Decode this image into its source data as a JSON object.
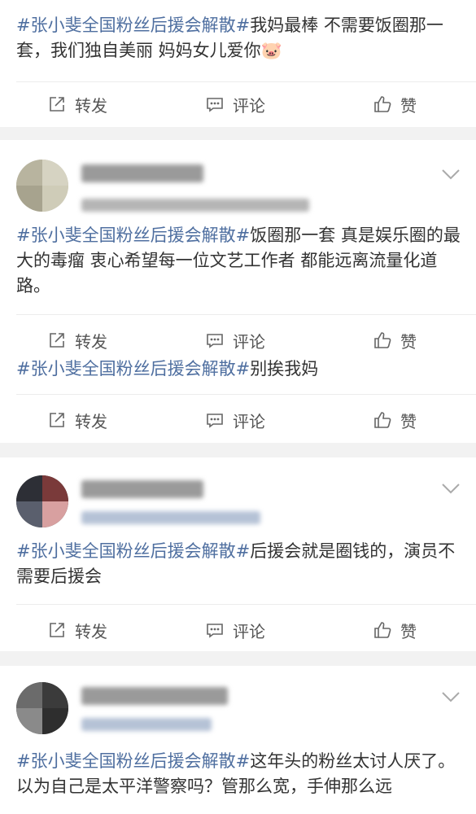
{
  "feed": {
    "posts": [
      {
        "hashtag": "#张小斐全国粉丝后援会解散#",
        "text": "我妈最棒 不需要饭圈那一套，我们独自美丽 妈妈女儿爱你",
        "emoji": "🐷",
        "actions": {
          "share": "转发",
          "comment": "评论",
          "like": "赞"
        }
      },
      {
        "hashtag": "#张小斐全国粉丝后援会解散#",
        "text": "饭圈那一套 真是娱乐圈的最大的毒瘤 衷心希望每一位文艺工作者 都能远离流量化道路。",
        "actions": {
          "share": "转发",
          "comment": "评论",
          "like": "赞"
        }
      },
      {
        "hashtag": "#张小斐全国粉丝后援会解散#",
        "text": "别挨我妈",
        "actions": {
          "share": "转发",
          "comment": "评论",
          "like": "赞"
        }
      },
      {
        "hashtag": "#张小斐全国粉丝后援会解散#",
        "text": "后援会就是圈钱的，演员不需要后援会",
        "actions": {
          "share": "转发",
          "comment": "评论",
          "like": "赞"
        }
      },
      {
        "hashtag": "#张小斐全国粉丝后援会解散#",
        "text": "这年头的粉丝太讨人厌了。以为自己是太平洋警察吗？管那么宽，手伸那么远",
        "actions": {}
      }
    ]
  },
  "colors": {
    "hashtag": "#4f6fa0",
    "text": "#333333",
    "action": "#555555",
    "separator": "#f2f2f2",
    "card": "#ffffff"
  },
  "icons": {
    "share": "share-box-arrow-icon",
    "comment": "comment-bubble-icon",
    "like": "thumbs-up-icon",
    "more": "chevron-down-icon"
  }
}
